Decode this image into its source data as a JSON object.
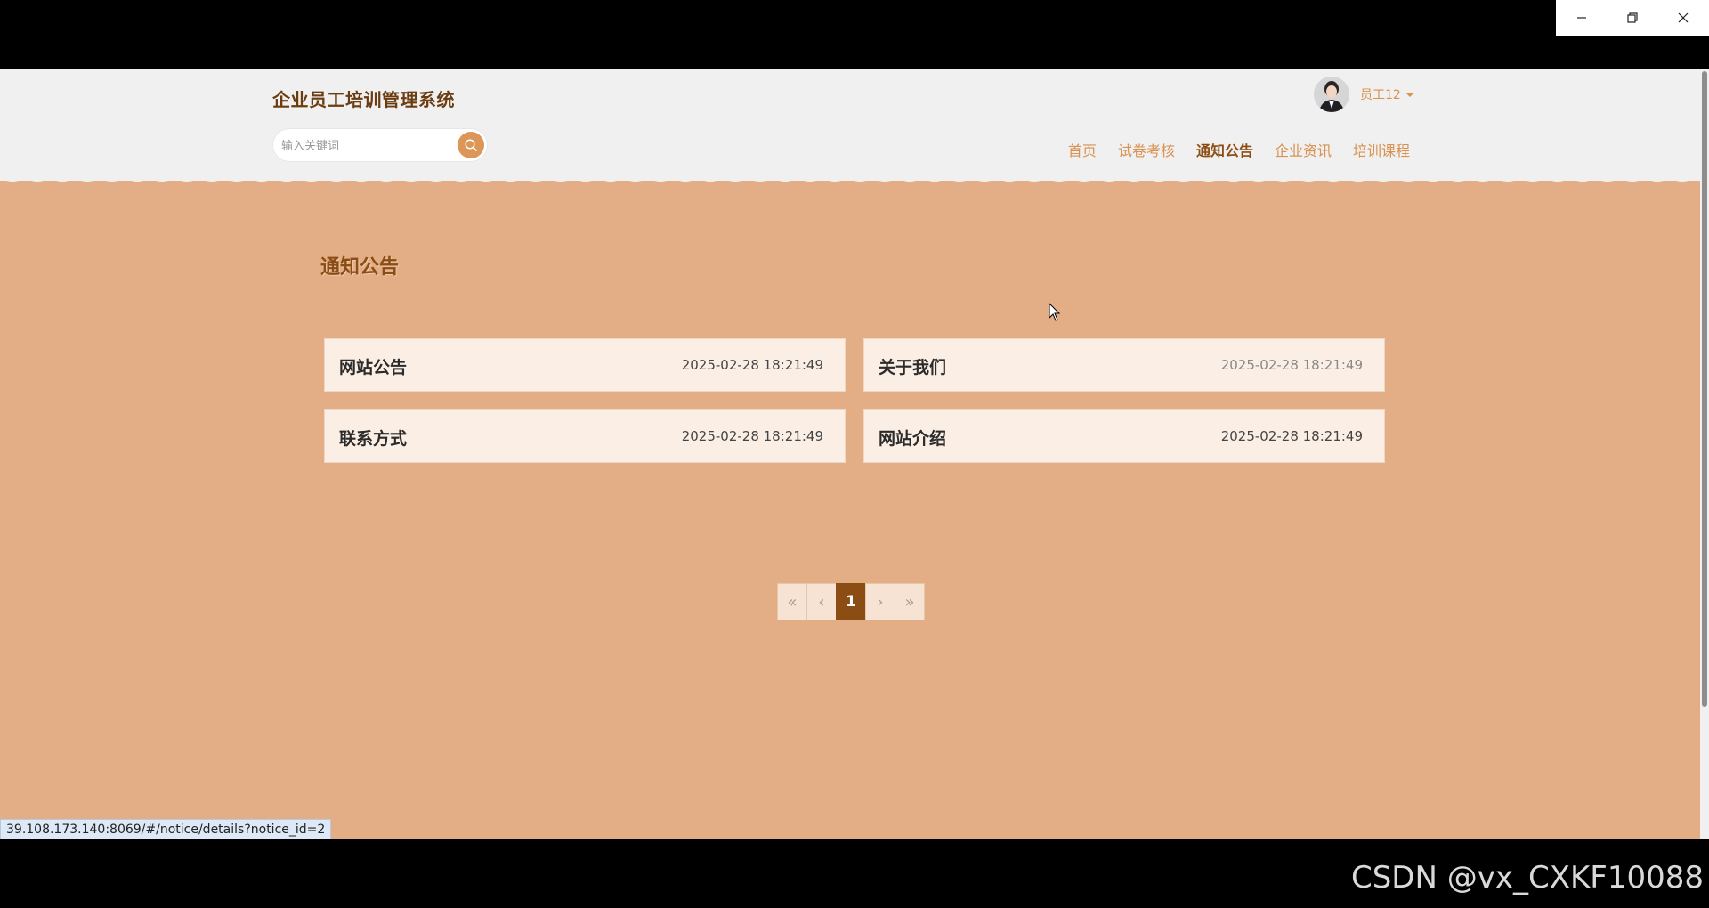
{
  "window": {
    "controls": [
      "minimize",
      "restore",
      "close"
    ]
  },
  "site": {
    "title": "企业员工培训管理系统",
    "search_placeholder": "输入关键词"
  },
  "user": {
    "name": "员工12"
  },
  "nav": {
    "items": [
      {
        "label": "首页",
        "active": false
      },
      {
        "label": "试卷考核",
        "active": false
      },
      {
        "label": "通知公告",
        "active": true
      },
      {
        "label": "企业资讯",
        "active": false
      },
      {
        "label": "培训课程",
        "active": false
      }
    ]
  },
  "main": {
    "heading": "通知公告",
    "notices": [
      {
        "title": "网站公告",
        "time": "2025-02-28 18:21:49"
      },
      {
        "title": "关于我们",
        "time": "2025-02-28 18:21:49"
      },
      {
        "title": "联系方式",
        "time": "2025-02-28 18:21:49"
      },
      {
        "title": "网站介绍",
        "time": "2025-02-28 18:21:49"
      }
    ]
  },
  "pagination": {
    "first": "«",
    "prev": "‹",
    "current": "1",
    "next": "›",
    "last": "»"
  },
  "status_bar": {
    "url": "39.108.173.140:8069/#/notice/details?notice_id=2"
  },
  "watermark": "CSDN @vx_CXKF10088",
  "colors": {
    "accent": "#d8914f",
    "dark_accent": "#8b4d13",
    "page_bg": "#e3ae86",
    "header_bg": "#f0f0f0"
  }
}
